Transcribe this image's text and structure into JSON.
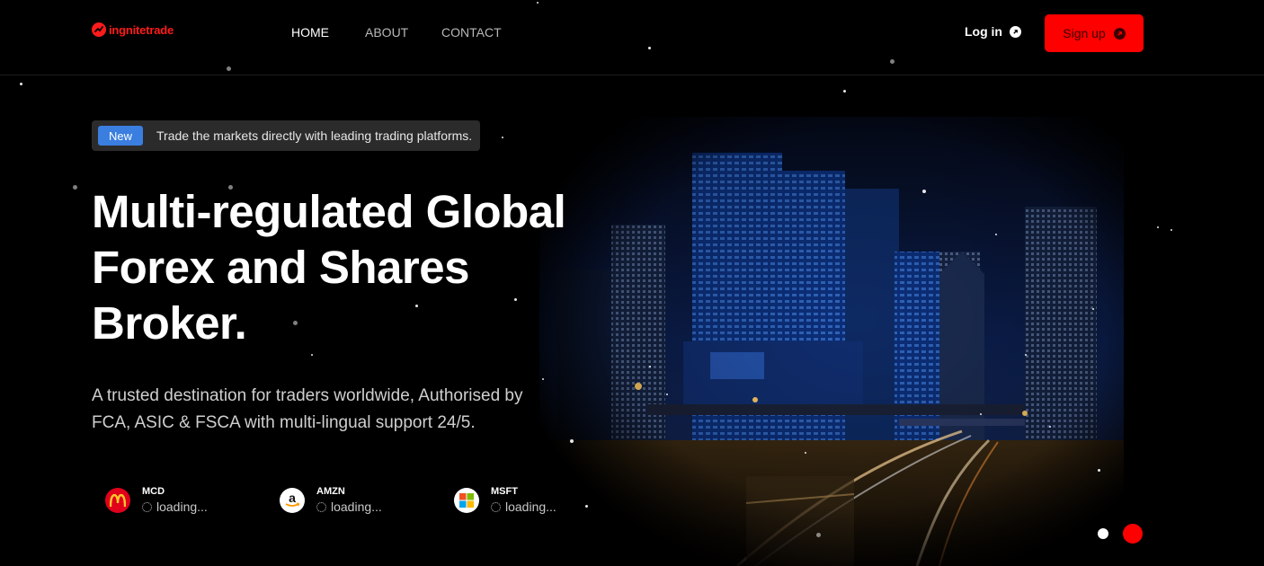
{
  "brand": {
    "name": "ingnitetrade",
    "color": "#ff1b1b"
  },
  "nav": {
    "items": [
      {
        "label": "HOME",
        "active": true
      },
      {
        "label": "ABOUT",
        "active": false
      },
      {
        "label": "CONTACT",
        "active": false
      }
    ]
  },
  "auth": {
    "login_label": "Log in",
    "signup_label": "Sign up",
    "signup_color": "#ff0000"
  },
  "hero": {
    "badge_tag": "New",
    "badge_text": "Trade the markets directly with leading trading platforms.",
    "headline_line1": "Multi-regulated Global",
    "headline_line2": "Forex and Shares",
    "headline_line3": "Broker.",
    "subtext": "A trusted destination for traders worldwide, Authorised by FCA, ASIC & FSCA with multi-lingual support 24/5."
  },
  "tickers": [
    {
      "symbol": "MCD",
      "status": "loading...",
      "icon": "mcdonalds-logo-icon"
    },
    {
      "symbol": "AMZN",
      "status": "loading...",
      "icon": "amazon-logo-icon"
    },
    {
      "symbol": "MSFT",
      "status": "loading...",
      "icon": "microsoft-logo-icon"
    }
  ],
  "slider": {
    "slide_count": 2,
    "active_index": 1
  },
  "colors": {
    "accent": "#ff0000",
    "badge_blue": "#3a7ee0",
    "background": "#000000"
  }
}
